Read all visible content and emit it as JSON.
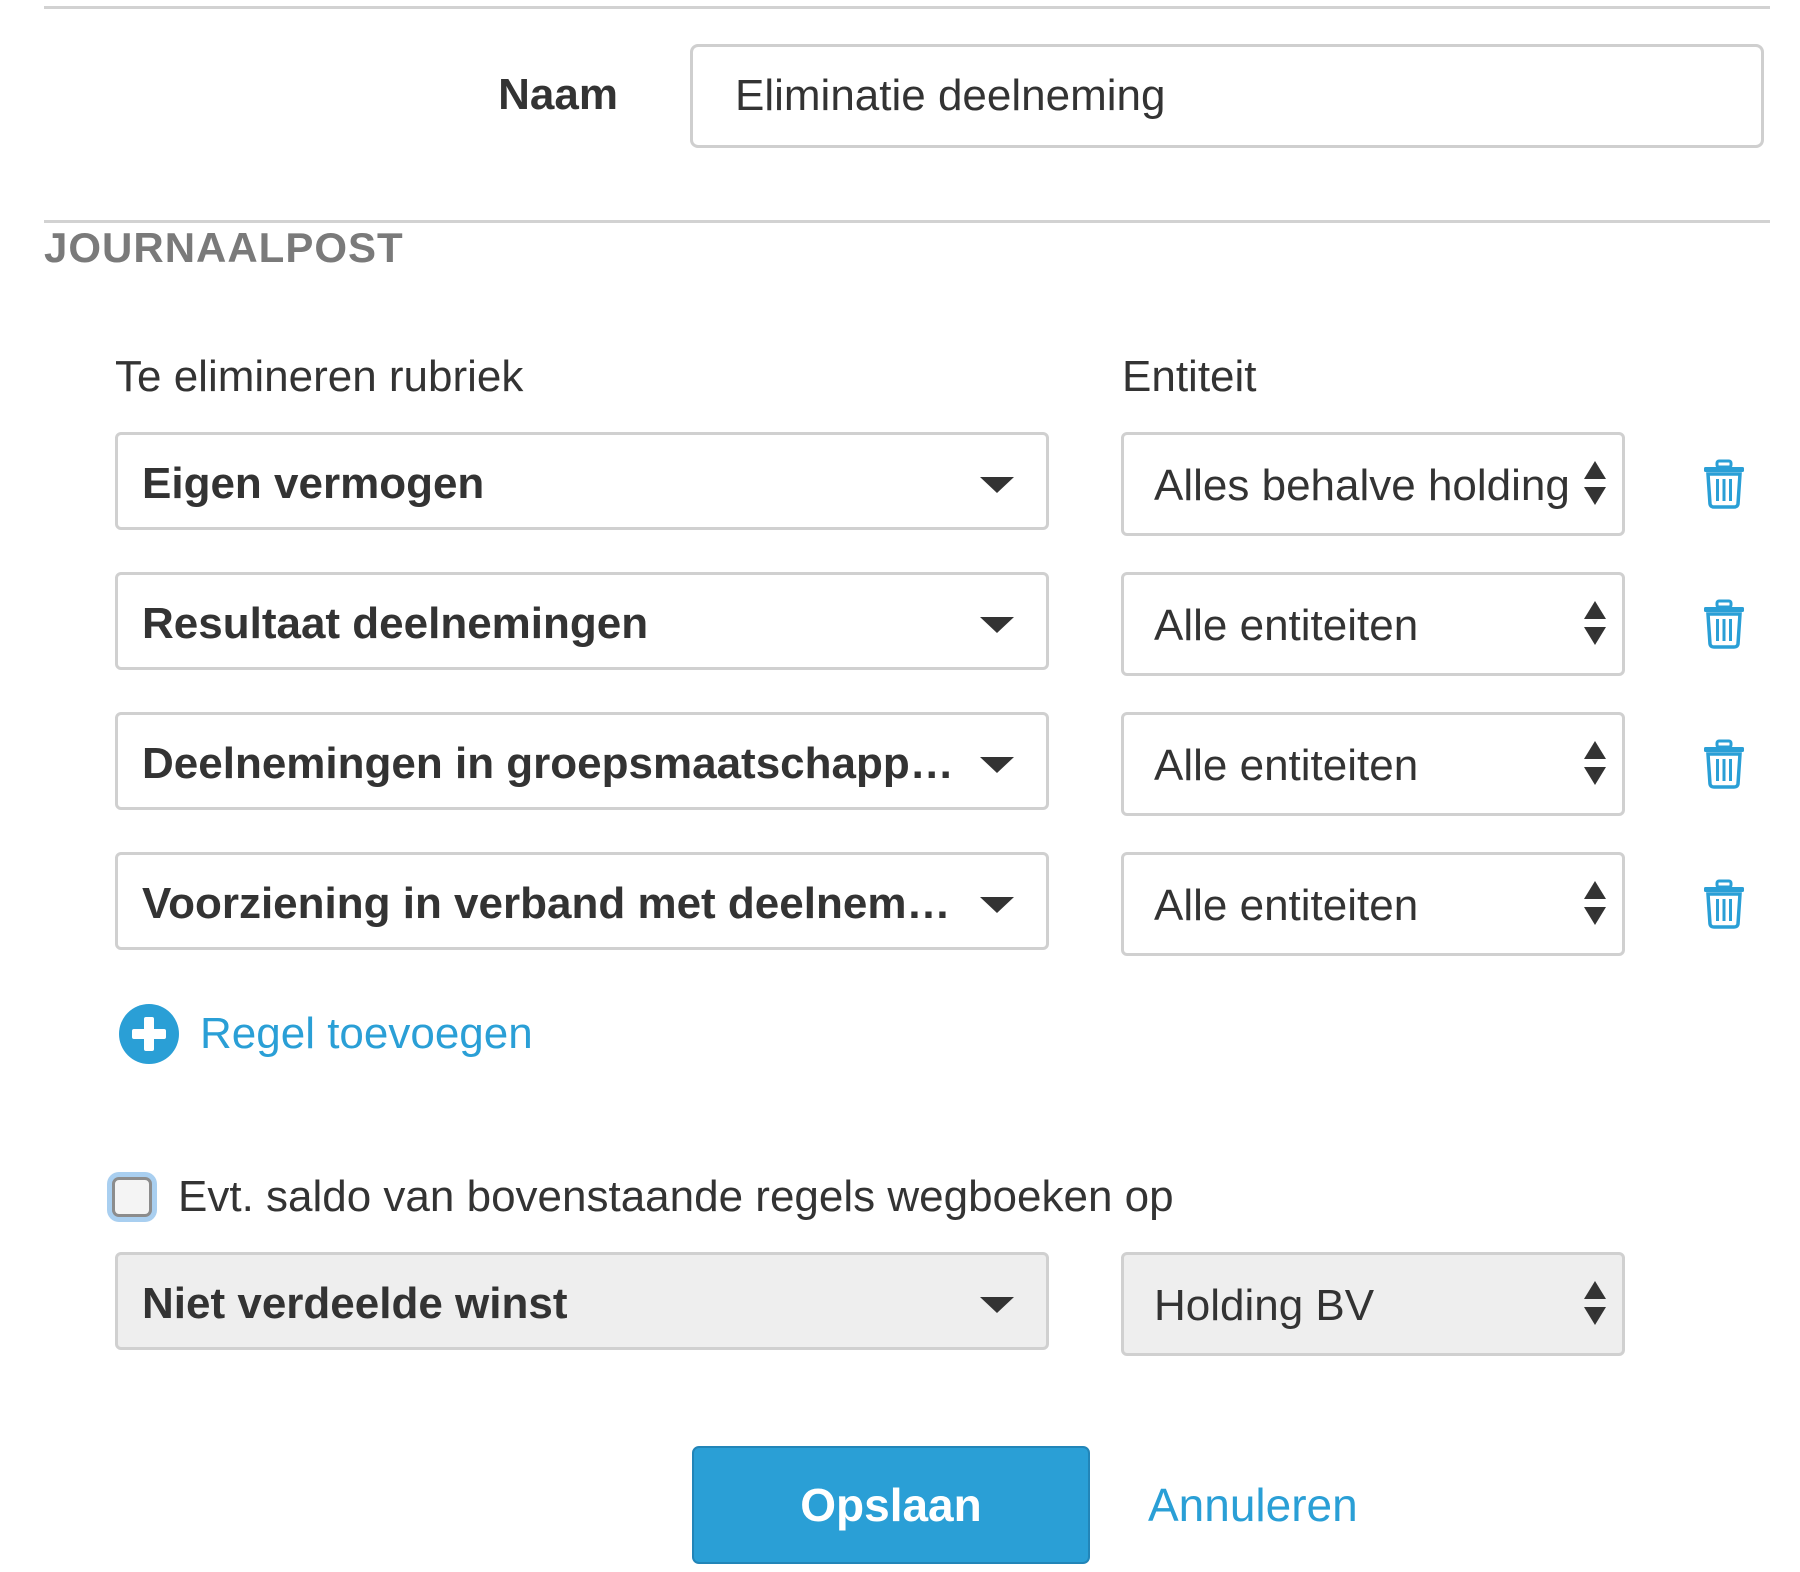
{
  "form": {
    "naam_label": "Naam",
    "naam_value": "Eliminatie deelneming"
  },
  "section": {
    "title": "JOURNAALPOST",
    "col_rubriek": "Te elimineren rubriek",
    "col_entiteit": "Entiteit"
  },
  "rows": [
    {
      "rubriek": "Eigen vermogen",
      "entiteit": "Alles behalve holding"
    },
    {
      "rubriek": "Resultaat deelnemingen",
      "entiteit": "Alle entiteiten"
    },
    {
      "rubriek": "Deelnemingen in groepsmaatschappijen",
      "entiteit": "Alle entiteiten"
    },
    {
      "rubriek": "Voorziening in verband met deelnemingen",
      "entiteit": "Alle entiteiten"
    }
  ],
  "add_line_label": "Regel toevoegen",
  "balance": {
    "checkbox_label": "Evt. saldo van bovenstaande regels wegboeken op",
    "checked": false,
    "rubriek": "Niet verdeelde winst",
    "entiteit": "Holding BV"
  },
  "actions": {
    "save_label": "Opslaan",
    "cancel_label": "Annuleren"
  },
  "colors": {
    "accent": "#2a9fd6",
    "border": "#d0d0d0",
    "section_title": "#7a7a7a"
  },
  "icons": {
    "row_delete": "trash-icon",
    "add": "plus-circle-icon",
    "rubriek_dropdown": "caret-down-icon",
    "entiteit_select": "updown-arrows-icon"
  }
}
